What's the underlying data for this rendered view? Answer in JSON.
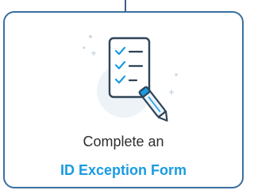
{
  "card": {
    "line1": "Complete an",
    "line2": "ID Exception Form"
  },
  "colors": {
    "border": "#3a6fa0",
    "accent": "#1a9be0",
    "text": "#2e2e2e",
    "icon_circle": "#eef3f8",
    "check": "#1a9be0"
  },
  "icon": "checklist-with-pen-icon"
}
